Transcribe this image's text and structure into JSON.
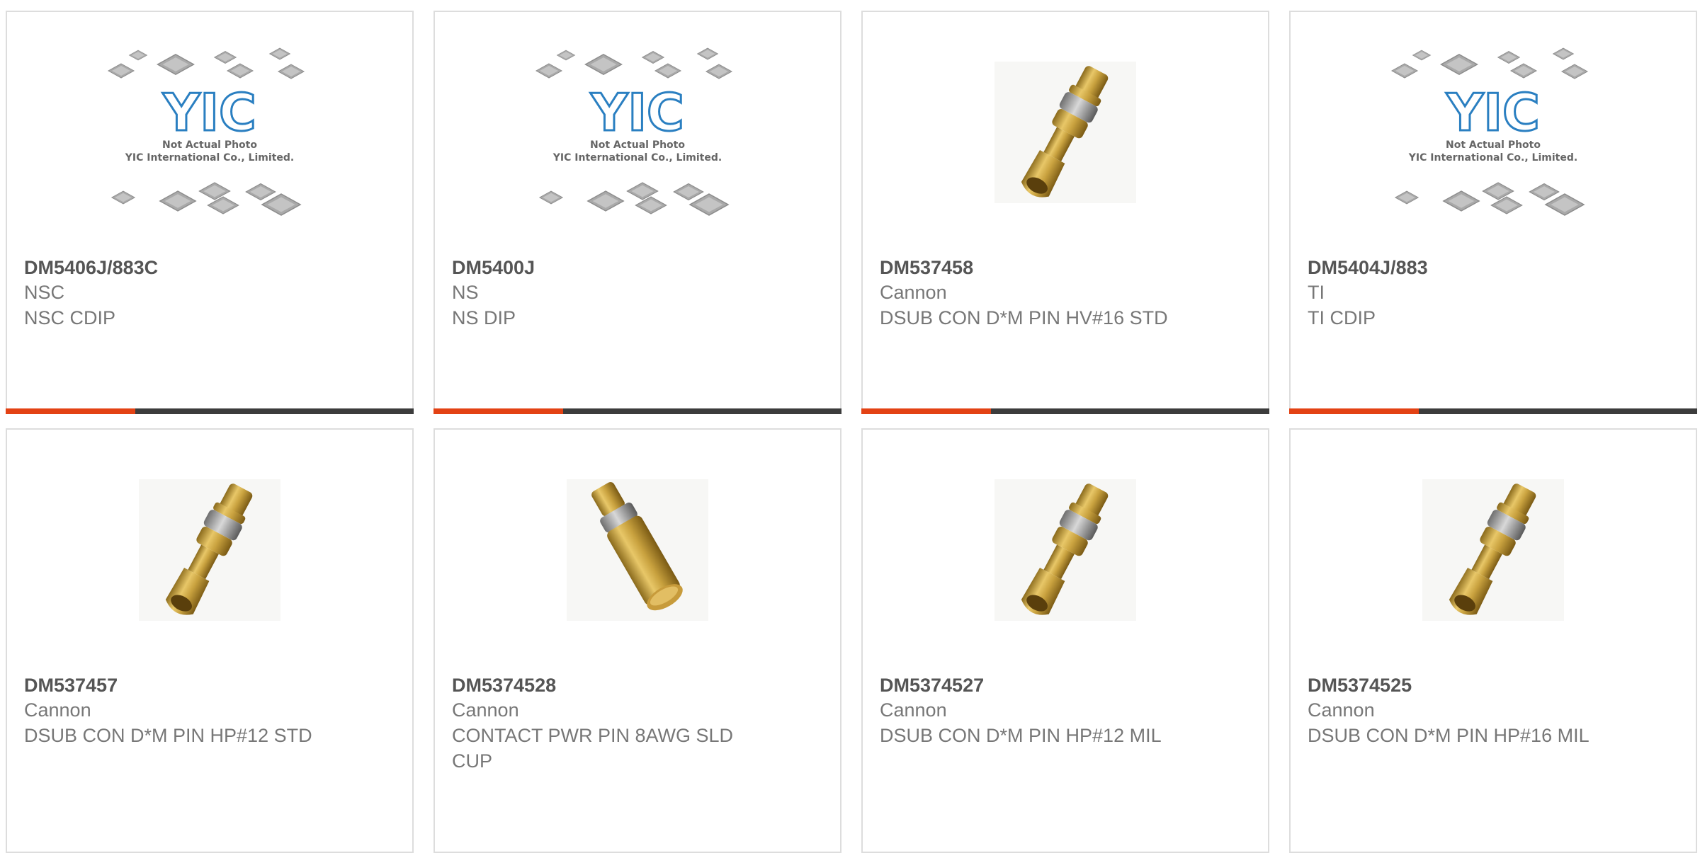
{
  "placeholder": {
    "logo_text": "YIC",
    "line1": "Not Actual Photo",
    "line2": "YIC International Co., Limited."
  },
  "accent_color": "#e34214",
  "products": [
    {
      "part": "DM5406J/883C",
      "manufacturer": "NSC",
      "description": "NSC CDIP",
      "image": "placeholder-logo"
    },
    {
      "part": "DM5400J",
      "manufacturer": "NS",
      "description": "NS DIP",
      "image": "placeholder-logo"
    },
    {
      "part": "DM537458",
      "manufacturer": "Cannon",
      "description": "DSUB CON D*M PIN HV#16 STD",
      "image": "gold-contact-pin"
    },
    {
      "part": "DM5404J/883",
      "manufacturer": "TI",
      "description": "TI CDIP",
      "image": "placeholder-logo"
    },
    {
      "part": "DM537457",
      "manufacturer": "Cannon",
      "description": "DSUB CON D*M PIN HP#12 STD",
      "image": "gold-contact-pin"
    },
    {
      "part": "DM5374528",
      "manufacturer": "Cannon",
      "description": "CONTACT PWR PIN 8AWG SLD CUP",
      "image": "gold-contact-pin-large"
    },
    {
      "part": "DM5374527",
      "manufacturer": "Cannon",
      "description": "DSUB CON D*M PIN HP#12 MIL",
      "image": "gold-contact-pin"
    },
    {
      "part": "DM5374525",
      "manufacturer": "Cannon",
      "description": "DSUB CON D*M PIN HP#16 MIL",
      "image": "gold-contact-pin"
    }
  ]
}
